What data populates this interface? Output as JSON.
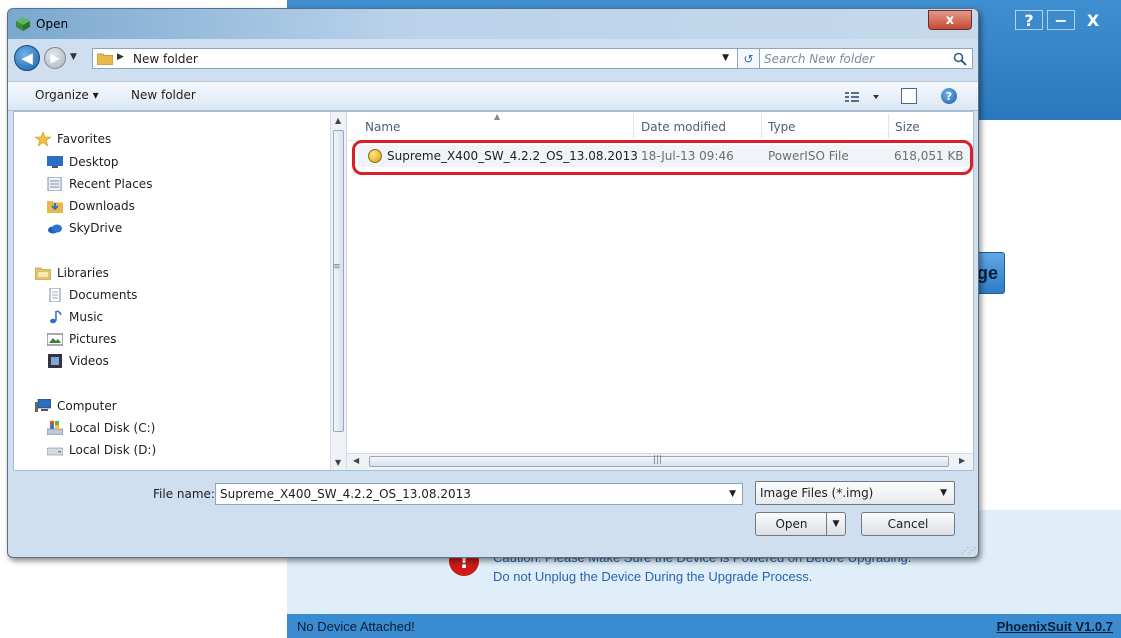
{
  "app": {
    "controls": [
      "?",
      "−",
      "X"
    ],
    "bg_button_text": "ge",
    "warning_line1": "Caution: Please Make Sure the Device is Powered on Before Upgrading.",
    "warning_line2": "Do not Unplug the Device During the Upgrade Process.",
    "status_left": "No Device Attached!",
    "status_right": "PhoenixSuit V1.0.7"
  },
  "dialog": {
    "title": "Open",
    "close": "x",
    "address": {
      "current_folder": "New folder"
    },
    "search": {
      "placeholder": "Search New folder"
    },
    "toolbar": {
      "organize": "Organize ▾",
      "new_folder": "New folder",
      "help": "?"
    },
    "nav": {
      "favorites": "Favorites",
      "desktop": "Desktop",
      "recent_places": "Recent Places",
      "downloads": "Downloads",
      "skydrive": "SkyDrive",
      "libraries": "Libraries",
      "documents": "Documents",
      "music": "Music",
      "pictures": "Pictures",
      "videos": "Videos",
      "computer": "Computer",
      "local_c": "Local Disk (C:)",
      "local_d": "Local Disk (D:)"
    },
    "columns": {
      "name": "Name",
      "date": "Date modified",
      "type": "Type",
      "size": "Size"
    },
    "files": [
      {
        "name": "Supreme_X400_SW_4.2.2_OS_13.08.2013",
        "date": "18-Jul-13 09:46",
        "type": "PowerISO File",
        "size": "618,051 KB"
      }
    ],
    "file_name_label": "File name:",
    "file_name_value": "Supreme_X400_SW_4.2.2_OS_13.08.2013",
    "file_type": "Image Files (*.img)",
    "open_button": "Open",
    "cancel_button": "Cancel",
    "colors": {
      "highlight": "#d81f2a",
      "app_blue": "#3b8bd0"
    }
  }
}
